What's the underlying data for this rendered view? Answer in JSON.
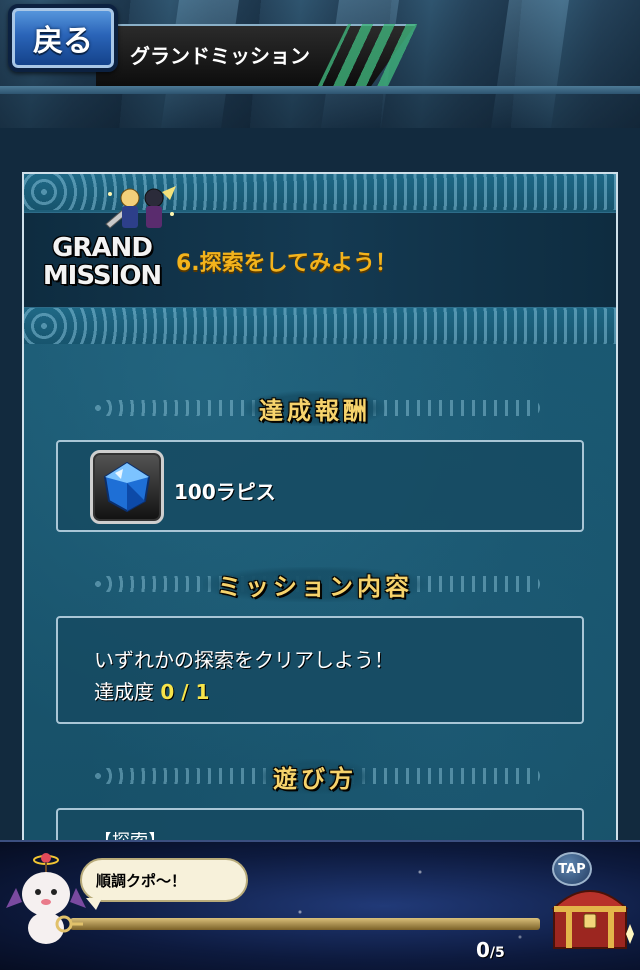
{
  "header": {
    "back_label": "戻る",
    "screen_title": "グランドミッション"
  },
  "mission": {
    "logo_text": [
      "GRAND",
      "MISSION"
    ],
    "title": "6.探索をしてみよう！"
  },
  "reward_section": {
    "heading": "達成報酬",
    "item_name": "100ラピス",
    "item_icon": "lapis-crystal-icon"
  },
  "content_section": {
    "heading": "ミッション内容",
    "description": "いずれかの探索をクリアしよう！",
    "progress_label": "達成度",
    "progress_value": "0 / 1"
  },
  "howto_section": {
    "heading": "遊び方",
    "peek_text": "【探索】"
  },
  "bottom_bar": {
    "speech": "順調クポ～！",
    "key_current": "0",
    "key_total": "/5",
    "key_progress_fraction": 0,
    "tap_label": "TAP"
  },
  "colors": {
    "mission_title": "#f3b31c",
    "section_heading": "#f6d36c",
    "progress_value": "#f7e44a",
    "back_button": "#2a64b8"
  }
}
